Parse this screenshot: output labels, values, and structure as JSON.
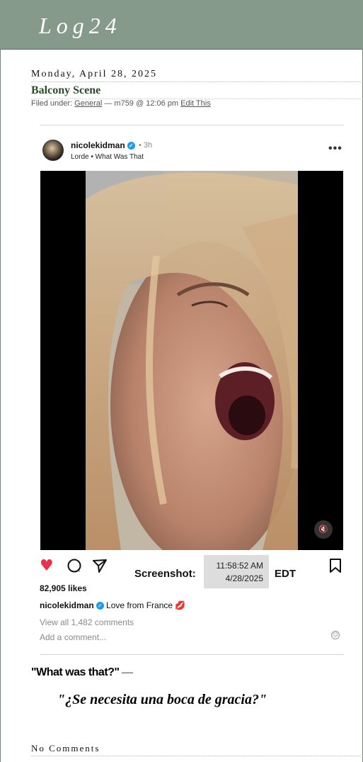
{
  "site": {
    "title": "Log24"
  },
  "post": {
    "date": "Monday, April 28, 2025",
    "title": "Balcony Scene",
    "meta_prefix": "Filed under: ",
    "category": "General",
    "meta_author": " — m759 @ 12:06 pm ",
    "edit_label": "Edit This"
  },
  "instagram": {
    "username": "nicolekidman",
    "verified_glyph": "✓",
    "time_ago": "• 3h",
    "audio": "Lorde • What Was That",
    "more": "•••",
    "mute_glyph": "🔇",
    "icons": {
      "heart": "heart-icon",
      "comment": "comment-icon",
      "share": "share-icon",
      "bookmark": "bookmark-icon"
    },
    "likes": "82,905 likes",
    "caption_user": "nicolekidman",
    "caption_text": " Love from France ",
    "caption_emoji": "💋",
    "view_comments": "View all 1,482 comments",
    "add_comment": "Add a comment...",
    "emoji_glyph": "☺",
    "colors": {
      "heart": "#ed2f4a",
      "verified": "#1d9bf0"
    }
  },
  "screenshot": {
    "label": "Screenshot:",
    "time": "11:58:52 AM",
    "date": "4/28/2025",
    "tz": "EDT"
  },
  "quotes": {
    "first": "\"What was that?\"",
    "first_dash": " —",
    "second": "\"¿Se necesita una boca de gracia?\""
  },
  "footer": {
    "comments": "No Comments"
  },
  "colors": {
    "header_bg": "#869a8c",
    "title_green": "#2c4a2c"
  }
}
